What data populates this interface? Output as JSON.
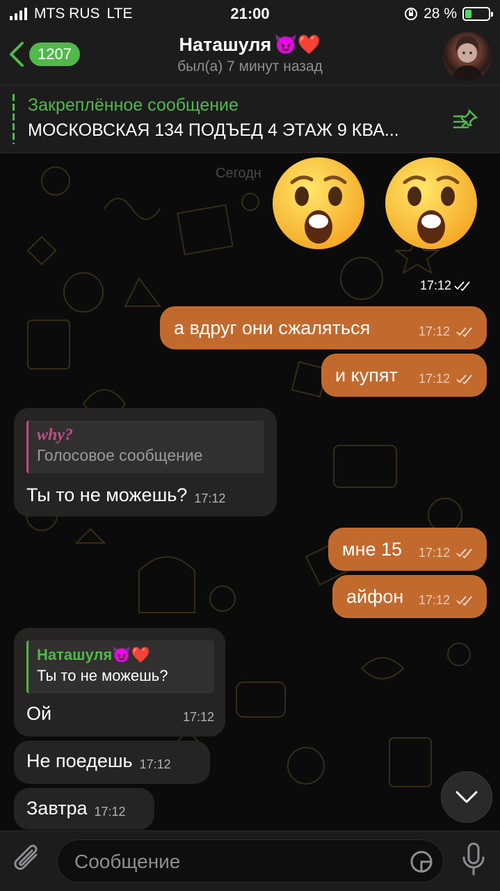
{
  "status_bar": {
    "carrier": "MTS RUS",
    "network": "LTE",
    "time": "21:00",
    "battery": "28 %",
    "battery_level": 0.28
  },
  "header": {
    "back_count": "1207",
    "name": "Наташуля",
    "name_emojis": "😈❤️",
    "status": "был(а) 7 минут назад"
  },
  "pinned": {
    "label": "Закреплённое сообщение",
    "text": "МОСКОВСКАЯ 134 ПОДЪЕД 4 ЭТАЖ 9 КВА..."
  },
  "date_pill": "Сегодн",
  "messages": [
    {
      "id": "m1",
      "direction": "out",
      "type": "emoji",
      "content": "😲😲",
      "time": "17:12",
      "read": true
    },
    {
      "id": "m2",
      "direction": "out",
      "text": "а вдруг они сжаляться",
      "time": "17:12",
      "read": true
    },
    {
      "id": "m3",
      "direction": "out",
      "text": "и купят",
      "time": "17:12",
      "read": true
    },
    {
      "id": "m4",
      "direction": "in",
      "reply_author": "why?",
      "reply_text": "Голосовое сообщение",
      "text": "Ты то не можешь?",
      "time": "17:12"
    },
    {
      "id": "m5",
      "direction": "out",
      "text": "мне 15",
      "time": "17:12",
      "read": true
    },
    {
      "id": "m6",
      "direction": "out",
      "text": "айфон",
      "time": "17:12",
      "read": true
    },
    {
      "id": "m7",
      "direction": "in",
      "reply_author": "Наташуля😈❤️",
      "reply_text": "Ты то не можешь?",
      "text": "Ой",
      "time": "17:12"
    },
    {
      "id": "m8",
      "direction": "in",
      "text": "Не поедешь",
      "time": "17:12"
    },
    {
      "id": "m9",
      "direction": "in",
      "text": "Завтра",
      "time": "17:12"
    }
  ],
  "composer": {
    "placeholder": "Сообщение"
  },
  "colors": {
    "accent_green": "#52b84b",
    "outgoing_bubble": "#c26a2e",
    "incoming_bubble": "#262422",
    "reply_pink": "#c24a8a"
  }
}
